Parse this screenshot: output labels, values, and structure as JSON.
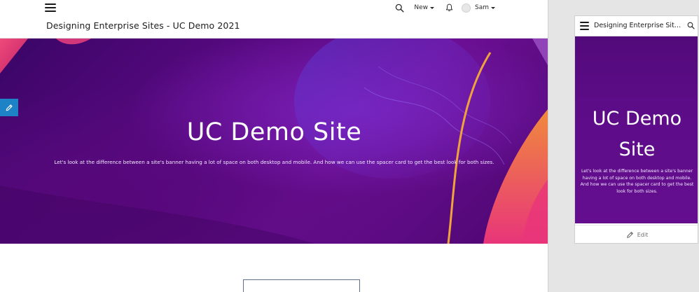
{
  "site_title": "Designing Enterprise Sites - UC Demo 2021",
  "desktop": {
    "header": {
      "new_label": "New",
      "user_label": "Sam"
    },
    "banner": {
      "title": "UC Demo Site",
      "text": "Let's look at the difference between a site's banner having a lot of space on both desktop and mobile. And how we can use the spacer card to get the best look for both sizes."
    }
  },
  "mobile": {
    "title": "Designing Enterprise Site...",
    "banner": {
      "title_line1": "UC Demo",
      "title_line2": "Site",
      "text": "Let's look at the difference between a site's banner having a lot of space on both desktop and mobile. And how we can use the spacer card to get the best look for both sizes."
    },
    "edit_label": "Edit"
  },
  "icons": {
    "menu": "hamburger-icon",
    "search": "search-icon",
    "notifications": "bell-icon",
    "edit": "pencil-icon",
    "dropdown": "caret-down-icon"
  },
  "colors": {
    "banner_purple": "#5c0a84",
    "accent_pink": "#e8357a",
    "accent_orange": "#f08a3c",
    "edit_tab_blue": "#1d82c6"
  }
}
